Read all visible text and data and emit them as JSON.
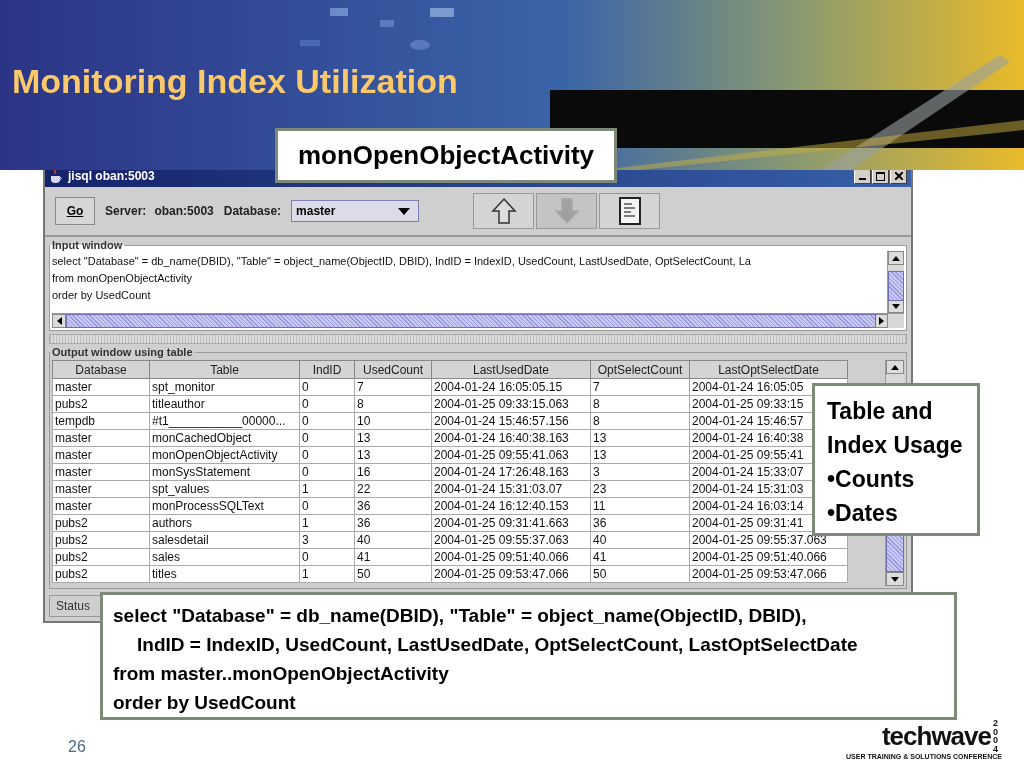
{
  "slide": {
    "title": "Monitoring Index Utilization",
    "page_number": "26"
  },
  "window": {
    "title": "jisql oban:5003"
  },
  "toolbar": {
    "go_button": "Go",
    "server_label": "Server:",
    "server": "oban:5003",
    "database_label": "Database:",
    "database": "master",
    "icon_buttons": [
      {
        "kind": "up",
        "disabled": false
      },
      {
        "kind": "down",
        "disabled": true
      },
      {
        "kind": "document",
        "disabled": false
      }
    ]
  },
  "input_window": {
    "title": "Input window",
    "lines": [
      "select \"Database\" = db_name(DBID), \"Table\" = object_name(ObjectID, DBID), IndID = IndexID, UsedCount, LastUsedDate, OptSelectCount, La",
      "from monOpenObjectActivity",
      "order by UsedCount"
    ]
  },
  "output_window": {
    "title": "Output window using table",
    "columns": [
      "Database",
      "Table",
      "IndID",
      "UsedCount",
      "LastUsedDate",
      "OptSelectCount",
      "LastOptSelectDate"
    ],
    "rows": [
      [
        "master",
        "spt_monitor",
        "0",
        "7",
        "2004-01-24 16:05:05.15",
        "7",
        "2004-01-24 16:05:05"
      ],
      [
        "pubs2",
        "titleauthor",
        "0",
        "8",
        "2004-01-25 09:33:15.063",
        "8",
        "2004-01-25 09:33:15"
      ],
      [
        "tempdb",
        "#t1___________00000...",
        "0",
        "10",
        "2004-01-24 15:46:57.156",
        "8",
        "2004-01-24 15:46:57"
      ],
      [
        "master",
        "monCachedObject",
        "0",
        "13",
        "2004-01-24 16:40:38.163",
        "13",
        "2004-01-24 16:40:38"
      ],
      [
        "master",
        "monOpenObjectActivity",
        "0",
        "13",
        "2004-01-25 09:55:41.063",
        "13",
        "2004-01-25 09:55:41"
      ],
      [
        "master",
        "monSysStatement",
        "0",
        "16",
        "2004-01-24 17:26:48.163",
        "3",
        "2004-01-24 15:33:07"
      ],
      [
        "master",
        "spt_values",
        "1",
        "22",
        "2004-01-24 15:31:03.07",
        "23",
        "2004-01-24 15:31:03"
      ],
      [
        "master",
        "monProcessSQLText",
        "0",
        "36",
        "2004-01-24 16:12:40.153",
        "11",
        "2004-01-24 16:03:14"
      ],
      [
        "pubs2",
        "authors",
        "1",
        "36",
        "2004-01-25 09:31:41.663",
        "36",
        "2004-01-25 09:31:41"
      ],
      [
        "pubs2",
        "salesdetail",
        "3",
        "40",
        "2004-01-25 09:55:37.063",
        "40",
        "2004-01-25 09:55:37.063"
      ],
      [
        "pubs2",
        "sales",
        "0",
        "41",
        "2004-01-25 09:51:40.066",
        "41",
        "2004-01-25 09:51:40.066"
      ],
      [
        "pubs2",
        "titles",
        "1",
        "50",
        "2004-01-25 09:53:47.066",
        "50",
        "2004-01-25 09:53:47.066"
      ]
    ]
  },
  "status_bar": "Status",
  "callouts": {
    "view_name": "monOpenObjectActivity",
    "usage_lines": [
      "Table and",
      "Index Usage",
      "•Counts",
      "•Dates"
    ],
    "query_lines": [
      {
        "text": "select \"Database\" = db_name(DBID), \"Table\" = object_name(ObjectID, DBID),",
        "indented": false
      },
      {
        "text": "IndID = IndexID, UsedCount, LastUsedDate, OptSelectCount, LastOptSelectDate",
        "indented": true
      },
      {
        "text": "from master..monOpenObjectActivity",
        "indented": false
      },
      {
        "text": "order by UsedCount",
        "indented": false
      }
    ]
  },
  "logo": {
    "name": "techwave",
    "year": "2004",
    "tagline": "USER TRAINING & SOLUTIONS CONFERENCE"
  }
}
